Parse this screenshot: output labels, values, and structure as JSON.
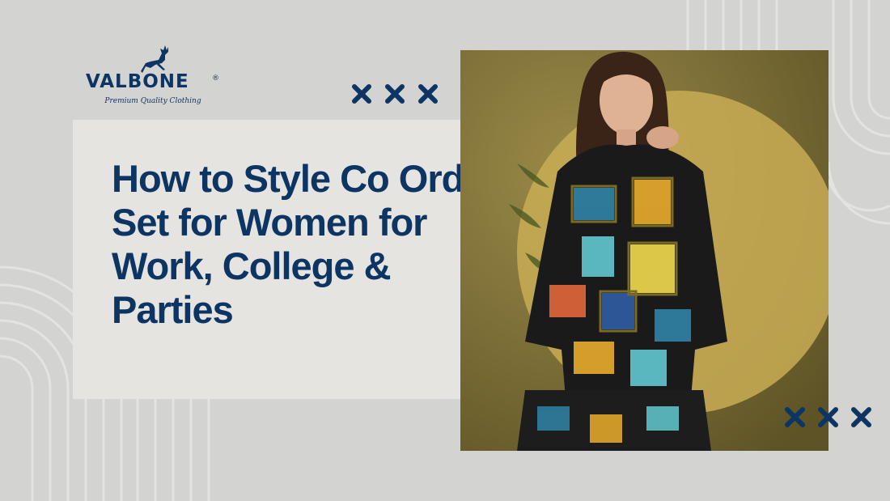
{
  "brand": {
    "name": "VALBONE",
    "registered_mark": "®",
    "tagline": "Premium Quality Clothing",
    "icon": "deer-icon"
  },
  "headline": "How to Style Co Ord Set for Women for Work, College & Parties",
  "decorations": {
    "x_mark_groups": [
      {
        "count": 3,
        "icon": "x-mark-icon"
      },
      {
        "count": 3,
        "icon": "x-mark-icon"
      }
    ]
  },
  "colors": {
    "navy": "#0d3563",
    "background": "#d3d3d1",
    "panel": "#e6e4e1",
    "photo_backdrop": "#8a7a3c",
    "backdrop_circle": "#c9ad55"
  }
}
